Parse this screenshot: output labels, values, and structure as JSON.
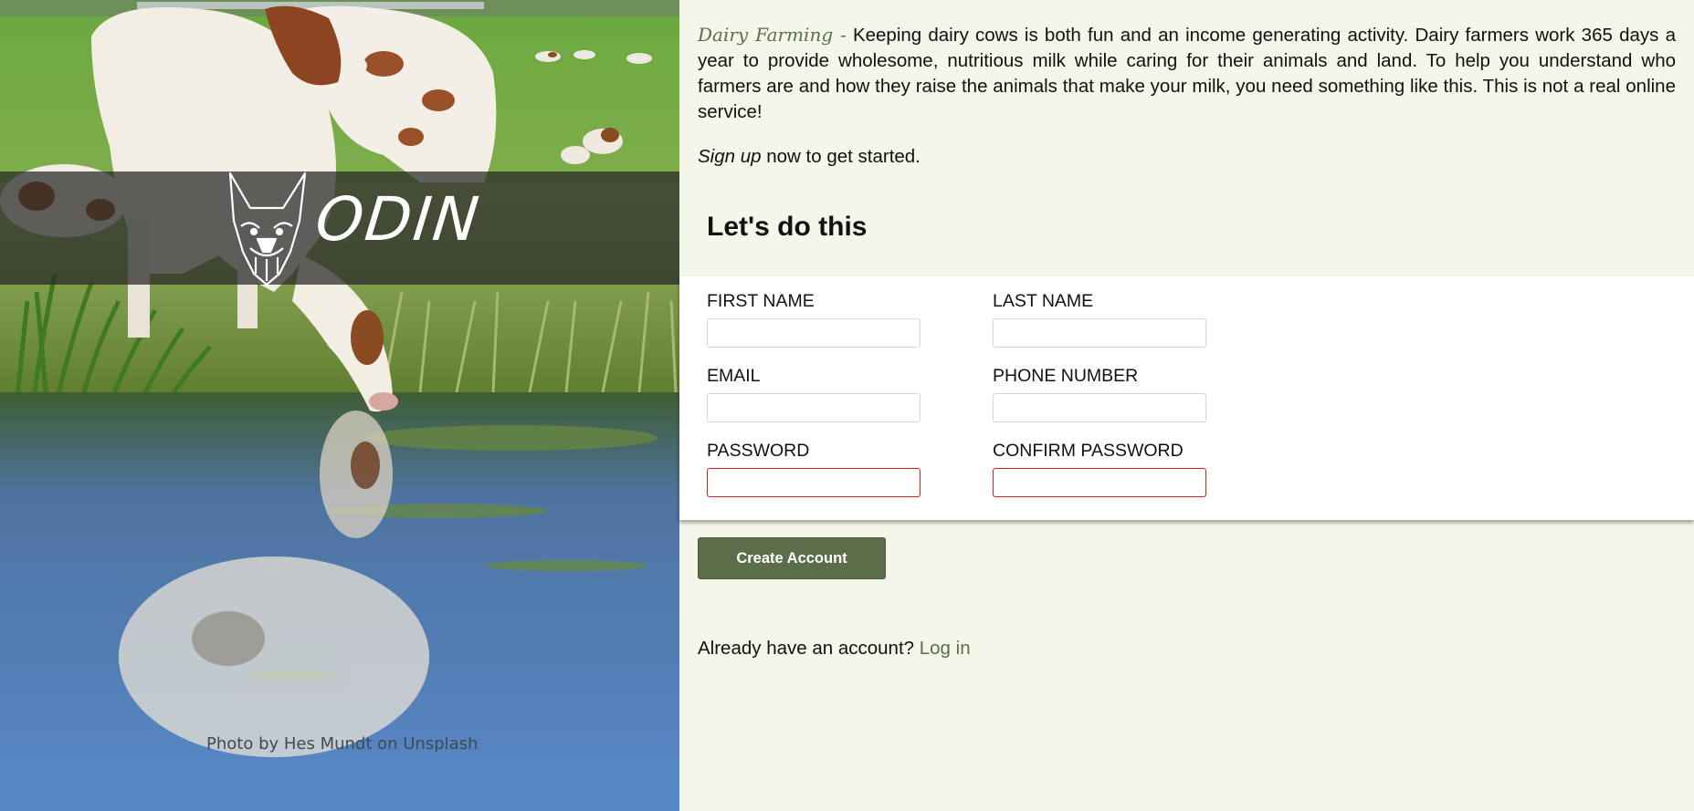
{
  "hero": {
    "logo_text": "ODIN",
    "logo_icon": "dog-head-icon",
    "photo_credit": "Photo by Hes Mundt on Unsplash"
  },
  "intro": {
    "brand": "Dairy Farming -",
    "text": "Keeping dairy cows is both fun and an income generating activity. Dairy farmers work 365 days a year to provide wholesome, nutritious milk while caring for their animals and land. To help you understand who farmers are and how they raise the animals that make your milk, you need something like this. This is not a real online service!"
  },
  "signup": {
    "emphasis": "Sign up",
    "rest": " now to get started."
  },
  "form": {
    "title": "Let's do this",
    "first_name_label": "FIRST NAME",
    "last_name_label": "LAST NAME",
    "email_label": "EMAIL",
    "phone_label": "PHONE NUMBER",
    "password_label": "PASSWORD",
    "confirm_password_label": "CONFIRM PASSWORD",
    "first_name_value": "",
    "last_name_value": "",
    "email_value": "",
    "phone_value": "",
    "password_value": "",
    "confirm_password_value": "",
    "invalid_border_color": "#d32020"
  },
  "actions": {
    "create_account_label": "Create Account"
  },
  "login": {
    "prompt": "Already have an account? ",
    "link_label": "Log in"
  },
  "colors": {
    "accent": "#5b6e49",
    "page_background": "#f5f6ea"
  }
}
